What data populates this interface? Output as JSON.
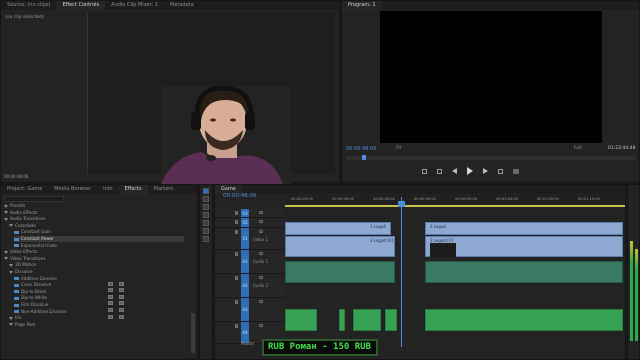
{
  "source_panel": {
    "tabs": [
      "Source: (no clips)",
      "Effect Controls",
      "Audio Clip Mixer: 1",
      "Metadata"
    ],
    "active_tab": 1,
    "empty_text": "(no clip selected)",
    "timecode": "00:00:48:06"
  },
  "program_panel": {
    "tab": "Program: 1",
    "timecode_current": "00:00:48:06",
    "fit": "Fit",
    "quality": "Full",
    "duration": "01:23:44:48"
  },
  "effects_panel": {
    "tabs": [
      "Project: Game",
      "Media Browser",
      "Info",
      "Effects",
      "Markers"
    ],
    "active_tab": 3,
    "tree": [
      {
        "label": "Presets",
        "indent": 1,
        "type": "folder"
      },
      {
        "label": "Audio Effects",
        "indent": 1,
        "type": "folder"
      },
      {
        "label": "Audio Transitions",
        "indent": 1,
        "type": "folder"
      },
      {
        "label": "Crossfade",
        "indent": 2,
        "type": "folder"
      },
      {
        "label": "Constant Gain",
        "indent": 3,
        "type": "fx"
      },
      {
        "label": "Constant Power",
        "indent": 3,
        "type": "fx",
        "selected": true
      },
      {
        "label": "Exponential Fade",
        "indent": 3,
        "type": "fx"
      },
      {
        "label": "Video Effects",
        "indent": 1,
        "type": "folder"
      },
      {
        "label": "Video Transitions",
        "indent": 1,
        "type": "folder"
      },
      {
        "label": "3D Motion",
        "indent": 2,
        "type": "folder"
      },
      {
        "label": "Dissolve",
        "indent": 2,
        "type": "folder"
      },
      {
        "label": "Additive Dissolve",
        "indent": 3,
        "type": "fx"
      },
      {
        "label": "Cross Dissolve",
        "indent": 3,
        "type": "fx"
      },
      {
        "label": "Dip to Black",
        "indent": 3,
        "type": "fx"
      },
      {
        "label": "Dip to White",
        "indent": 3,
        "type": "fx"
      },
      {
        "label": "Film Dissolve",
        "indent": 3,
        "type": "fx"
      },
      {
        "label": "Non-Additive Dissolve",
        "indent": 3,
        "type": "fx"
      },
      {
        "label": "Iris",
        "indent": 2,
        "type": "folder"
      },
      {
        "label": "Page Peel",
        "indent": 2,
        "type": "folder"
      }
    ]
  },
  "timeline": {
    "tab": "Game",
    "timecode": "00:00:48:06",
    "ruler": [
      "00:00:25:00",
      "00:00:30:00",
      "00:00:45:00",
      "00:00:50:00",
      "00:00:55:00",
      "00:01:00:00",
      "00:01:05:00",
      "00:01:10:00"
    ],
    "tracks": [
      {
        "name": "V3",
        "label": ""
      },
      {
        "name": "V2",
        "label": ""
      },
      {
        "name": "V1",
        "label": "Video 1"
      },
      {
        "name": "A1",
        "label": "Audio 1"
      },
      {
        "name": "A2",
        "label": "Audio 2"
      },
      {
        "name": "A3",
        "label": ""
      },
      {
        "name": "A4",
        "label": ""
      }
    ],
    "master": "Master",
    "clips": {
      "v2a": "3 Lega4",
      "v1a": "3 Lega4 [V]",
      "v2b": "3 Lega4",
      "v1b": "3 Lega4 [V]"
    }
  },
  "overlay": {
    "ticker": "RUB       Роман - 150 RUB"
  }
}
